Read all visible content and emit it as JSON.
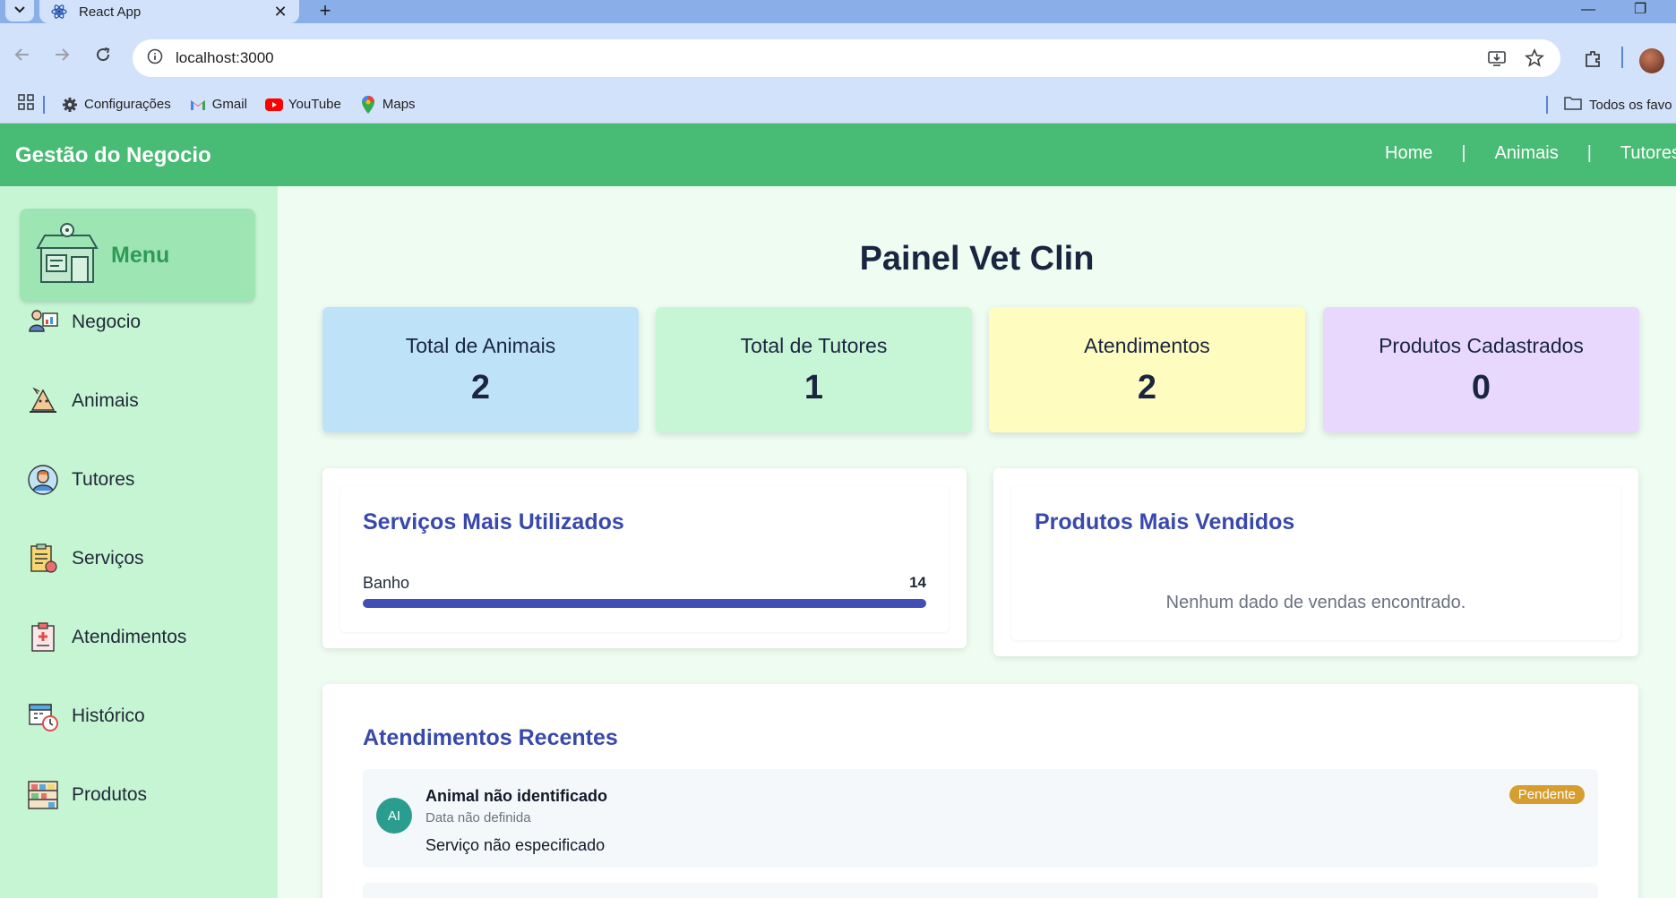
{
  "browser": {
    "tab_title": "React App",
    "url": "localhost:3000",
    "bookmarks": [
      {
        "label": "Configurações",
        "icon": "gear-icon"
      },
      {
        "label": "Gmail",
        "icon": "gmail-icon"
      },
      {
        "label": "YouTube",
        "icon": "youtube-icon"
      },
      {
        "label": "Maps",
        "icon": "maps-icon"
      }
    ],
    "bookmarks_folder": "Todos os favo"
  },
  "header": {
    "brand": "Gestão do Negocio",
    "nav": [
      "Home",
      "Animais",
      "Tutores"
    ],
    "nav_separator": "|"
  },
  "sidebar": {
    "menu_label": "Menu",
    "items": [
      {
        "label": "Negocio",
        "icon": "business-icon"
      },
      {
        "label": "Animais",
        "icon": "animal-icon"
      },
      {
        "label": "Tutores",
        "icon": "tutor-icon"
      },
      {
        "label": "Serviços",
        "icon": "services-icon"
      },
      {
        "label": "Atendimentos",
        "icon": "appointments-icon"
      },
      {
        "label": "Histórico",
        "icon": "history-icon"
      },
      {
        "label": "Produtos",
        "icon": "products-icon"
      }
    ]
  },
  "dashboard": {
    "title": "Painel Vet Clin",
    "stats": [
      {
        "label": "Total de Animais",
        "value": "2",
        "color": "#bee3f8"
      },
      {
        "label": "Total de Tutores",
        "value": "1",
        "color": "#c6f6d5"
      },
      {
        "label": "Atendimentos",
        "value": "2",
        "color": "#fefcbf"
      },
      {
        "label": "Produtos Cadastrados",
        "value": "0",
        "color": "#e9d8fd"
      }
    ],
    "services": {
      "title": "Serviços Mais Utilizados",
      "items": [
        {
          "label": "Banho",
          "value": "14",
          "fraction": 1.0
        }
      ]
    },
    "products": {
      "title": "Produtos Mais Vendidos",
      "empty_message": "Nenhum dado de vendas encontrado."
    },
    "recent": {
      "title": "Atendimentos Recentes",
      "items": [
        {
          "initials": "AI",
          "animal": "Animal não identificado",
          "date": "Data não definida",
          "service": "Serviço não especificado",
          "status": "Pendente"
        }
      ]
    }
  },
  "colors": {
    "header_green": "#48bb74",
    "sidebar_green": "#c6f5d4",
    "accent_indigo": "#3949ab",
    "badge_pending": "#d69e2e"
  }
}
